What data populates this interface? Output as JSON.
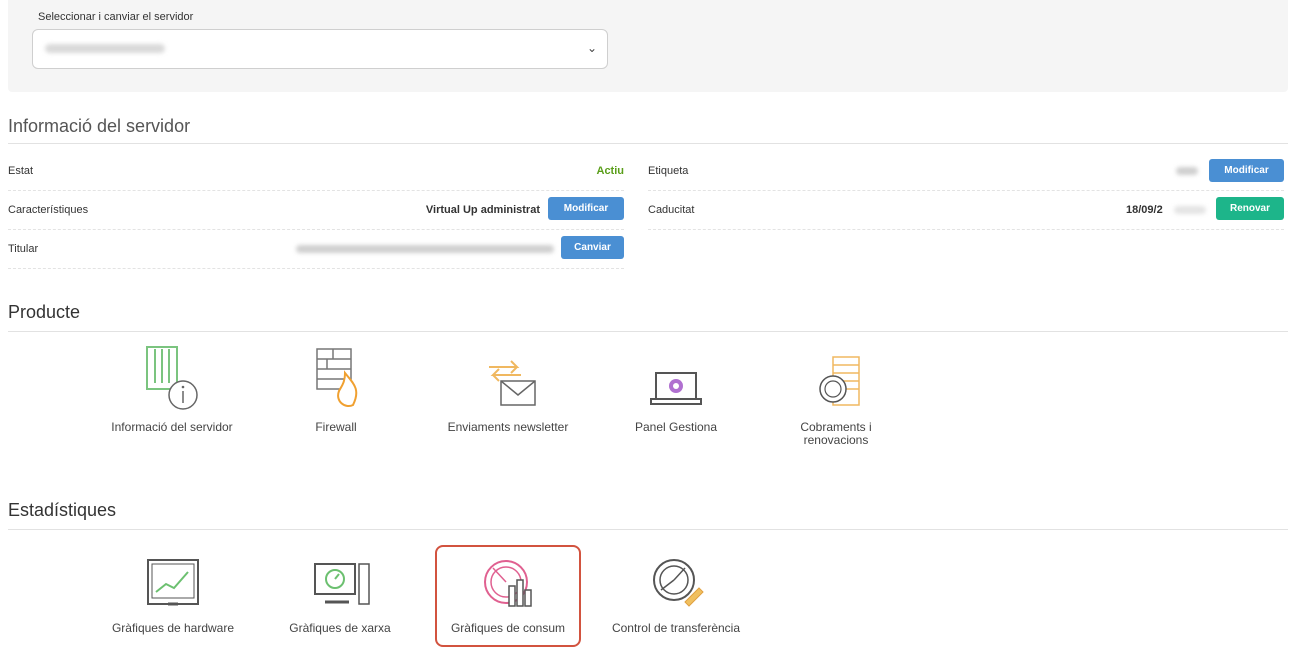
{
  "server_selector": {
    "label": "Seleccionar i canviar el servidor"
  },
  "server_info": {
    "title": "Informació del servidor",
    "rows_left": [
      {
        "label": "Estat",
        "value": "Actiu"
      },
      {
        "label": "Característiques",
        "value": "Virtual Up administrat",
        "button": "Modificar"
      },
      {
        "label": "Titular",
        "button": "Canviar"
      }
    ],
    "rows_right": [
      {
        "label": "Etiqueta",
        "button": "Modificar"
      },
      {
        "label": "Caducitat",
        "value": "18/09/2",
        "button": "Renovar"
      }
    ]
  },
  "producte": {
    "title": "Producte",
    "items": [
      {
        "label": "Informació del servidor",
        "icon": "server-info-icon"
      },
      {
        "label": "Firewall",
        "icon": "firewall-icon"
      },
      {
        "label": "Enviaments newsletter",
        "icon": "newsletter-icon"
      },
      {
        "label": "Panel Gestiona",
        "icon": "laptop-panel-icon"
      },
      {
        "label": "Cobraments i renovacions",
        "icon": "billing-icon"
      }
    ]
  },
  "estadistiques": {
    "title": "Estadístiques",
    "items": [
      {
        "label": "Gràfiques de hardware",
        "icon": "hardware-chart-icon"
      },
      {
        "label": "Gràfiques de xarxa",
        "icon": "network-chart-icon"
      },
      {
        "label": "Gràfiques de consum",
        "icon": "consumption-chart-icon",
        "highlighted": true
      },
      {
        "label": "Control de transferència",
        "icon": "transfer-control-icon"
      }
    ]
  },
  "colors": {
    "status_active": "#5a9e1a",
    "button_blue": "#4a8fd3",
    "button_green": "#1db58a",
    "highlight_border": "#d2533f"
  }
}
